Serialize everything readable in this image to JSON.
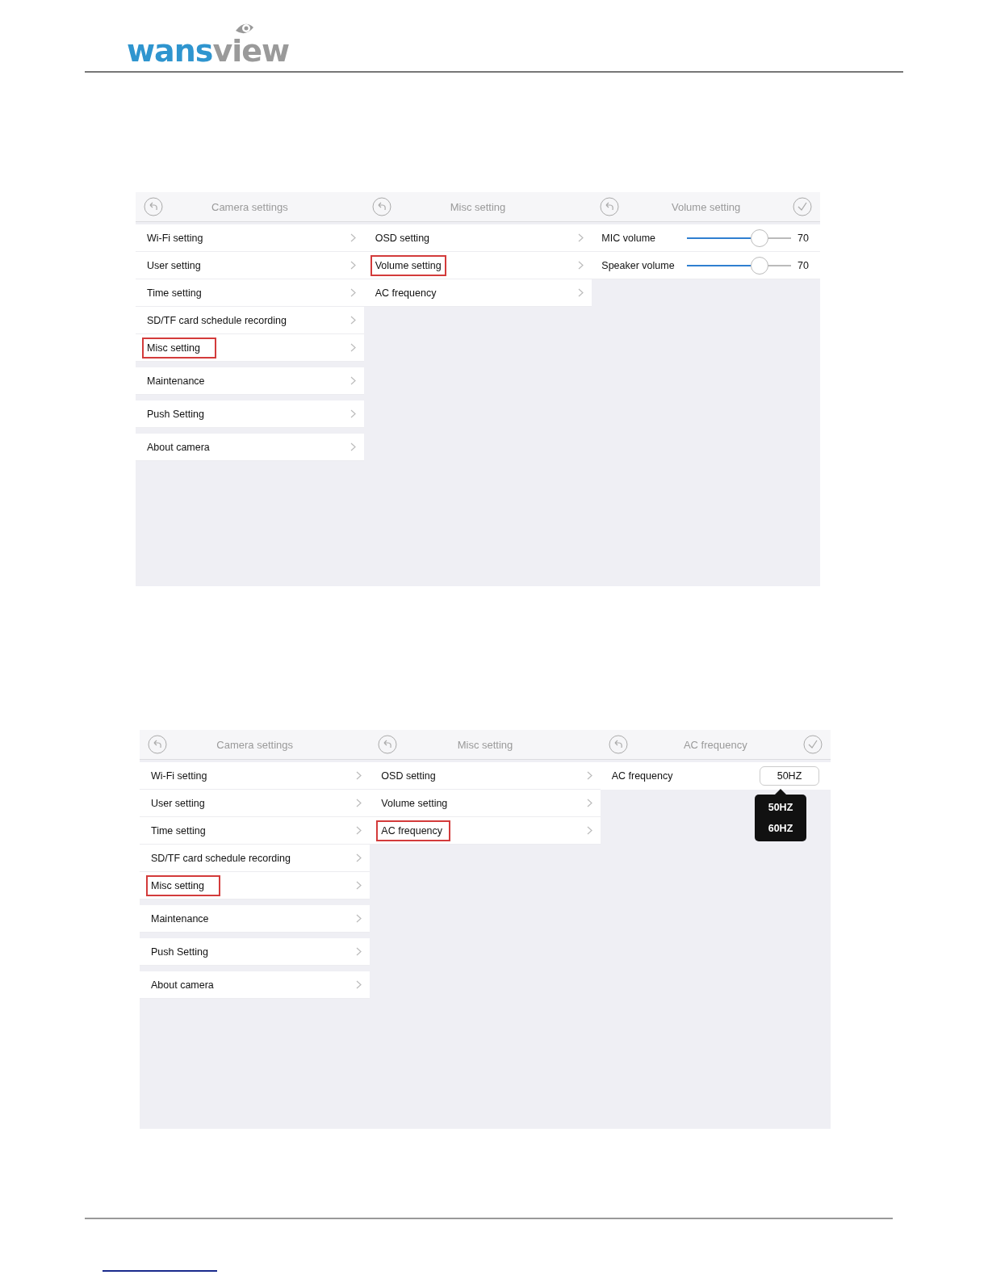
{
  "logo": {
    "part_1": "wans",
    "part_2": "view"
  },
  "screenshots": [
    {
      "panels": [
        {
          "kind": "menu",
          "title": "Camera settings",
          "confirm": false,
          "groups": [
            [
              {
                "label": "Wi-Fi setting",
                "highlighted": false
              },
              {
                "label": "User setting",
                "highlighted": false
              },
              {
                "label": "Time setting",
                "highlighted": false
              },
              {
                "label": "SD/TF card schedule recording",
                "highlighted": false
              },
              {
                "label": "Misc setting",
                "highlighted": true
              }
            ],
            [
              {
                "label": "Maintenance",
                "highlighted": false
              }
            ],
            [
              {
                "label": "Push Setting",
                "highlighted": false
              }
            ],
            [
              {
                "label": "About camera",
                "highlighted": false
              }
            ]
          ]
        },
        {
          "kind": "menu",
          "title": "Misc setting",
          "confirm": false,
          "groups": [
            [
              {
                "label": "OSD setting",
                "highlighted": false
              },
              {
                "label": "Volume setting",
                "highlighted": true
              },
              {
                "label": "AC frequency",
                "highlighted": false
              }
            ]
          ]
        },
        {
          "kind": "sliders",
          "title": "Volume setting",
          "confirm": true,
          "sliders": [
            {
              "label": "MIC volume",
              "level": 0.7,
              "reading": "70"
            },
            {
              "label": "Speaker volume",
              "level": 0.7,
              "reading": "70"
            }
          ]
        }
      ]
    },
    {
      "panels": [
        {
          "kind": "menu",
          "title": "Camera settings",
          "confirm": false,
          "groups": [
            [
              {
                "label": "Wi-Fi setting",
                "highlighted": false
              },
              {
                "label": "User setting",
                "highlighted": false
              },
              {
                "label": "Time setting",
                "highlighted": false
              },
              {
                "label": "SD/TF card schedule recording",
                "highlighted": false
              },
              {
                "label": "Misc setting",
                "highlighted": true
              }
            ],
            [
              {
                "label": "Maintenance",
                "highlighted": false
              }
            ],
            [
              {
                "label": "Push Setting",
                "highlighted": false
              }
            ],
            [
              {
                "label": "About camera",
                "highlighted": false
              }
            ]
          ]
        },
        {
          "kind": "menu",
          "title": "Misc setting",
          "confirm": false,
          "groups": [
            [
              {
                "label": "OSD setting",
                "highlighted": false
              },
              {
                "label": "Volume setting",
                "highlighted": false
              },
              {
                "label": "AC frequency",
                "highlighted": true
              }
            ]
          ]
        },
        {
          "kind": "select",
          "title": "AC frequency",
          "confirm": true,
          "field": {
            "label": "AC frequency",
            "value": "50HZ",
            "expanded": true,
            "options": [
              "50HZ",
              "60HZ"
            ]
          }
        }
      ]
    }
  ]
}
